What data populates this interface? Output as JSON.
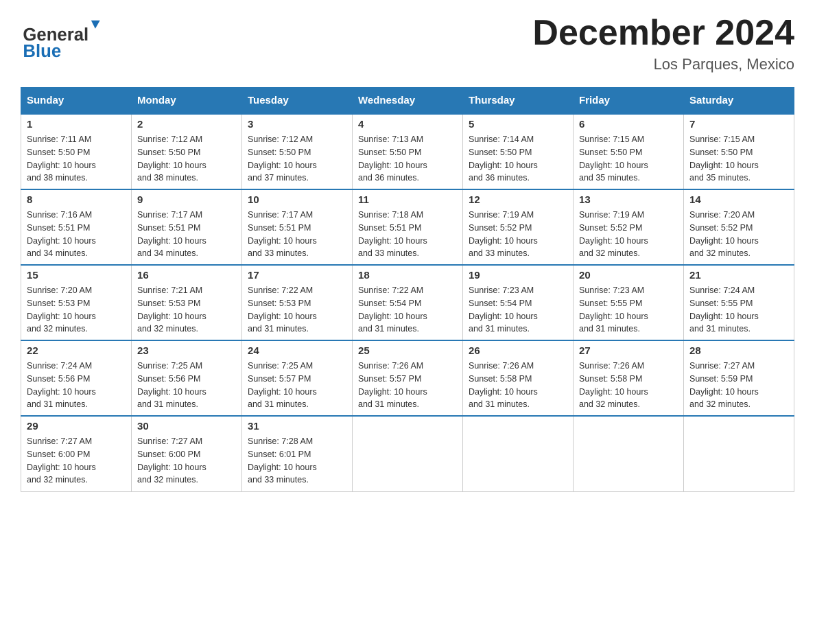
{
  "logo": {
    "general": "General",
    "blue": "Blue",
    "arrow_color": "#1a6eb5"
  },
  "title": {
    "month_year": "December 2024",
    "location": "Los Parques, Mexico"
  },
  "header_days": [
    "Sunday",
    "Monday",
    "Tuesday",
    "Wednesday",
    "Thursday",
    "Friday",
    "Saturday"
  ],
  "weeks": [
    [
      {
        "day": "1",
        "sunrise": "7:11 AM",
        "sunset": "5:50 PM",
        "daylight": "10 hours and 38 minutes."
      },
      {
        "day": "2",
        "sunrise": "7:12 AM",
        "sunset": "5:50 PM",
        "daylight": "10 hours and 38 minutes."
      },
      {
        "day": "3",
        "sunrise": "7:12 AM",
        "sunset": "5:50 PM",
        "daylight": "10 hours and 37 minutes."
      },
      {
        "day": "4",
        "sunrise": "7:13 AM",
        "sunset": "5:50 PM",
        "daylight": "10 hours and 36 minutes."
      },
      {
        "day": "5",
        "sunrise": "7:14 AM",
        "sunset": "5:50 PM",
        "daylight": "10 hours and 36 minutes."
      },
      {
        "day": "6",
        "sunrise": "7:15 AM",
        "sunset": "5:50 PM",
        "daylight": "10 hours and 35 minutes."
      },
      {
        "day": "7",
        "sunrise": "7:15 AM",
        "sunset": "5:50 PM",
        "daylight": "10 hours and 35 minutes."
      }
    ],
    [
      {
        "day": "8",
        "sunrise": "7:16 AM",
        "sunset": "5:51 PM",
        "daylight": "10 hours and 34 minutes."
      },
      {
        "day": "9",
        "sunrise": "7:17 AM",
        "sunset": "5:51 PM",
        "daylight": "10 hours and 34 minutes."
      },
      {
        "day": "10",
        "sunrise": "7:17 AM",
        "sunset": "5:51 PM",
        "daylight": "10 hours and 33 minutes."
      },
      {
        "day": "11",
        "sunrise": "7:18 AM",
        "sunset": "5:51 PM",
        "daylight": "10 hours and 33 minutes."
      },
      {
        "day": "12",
        "sunrise": "7:19 AM",
        "sunset": "5:52 PM",
        "daylight": "10 hours and 33 minutes."
      },
      {
        "day": "13",
        "sunrise": "7:19 AM",
        "sunset": "5:52 PM",
        "daylight": "10 hours and 32 minutes."
      },
      {
        "day": "14",
        "sunrise": "7:20 AM",
        "sunset": "5:52 PM",
        "daylight": "10 hours and 32 minutes."
      }
    ],
    [
      {
        "day": "15",
        "sunrise": "7:20 AM",
        "sunset": "5:53 PM",
        "daylight": "10 hours and 32 minutes."
      },
      {
        "day": "16",
        "sunrise": "7:21 AM",
        "sunset": "5:53 PM",
        "daylight": "10 hours and 32 minutes."
      },
      {
        "day": "17",
        "sunrise": "7:22 AM",
        "sunset": "5:53 PM",
        "daylight": "10 hours and 31 minutes."
      },
      {
        "day": "18",
        "sunrise": "7:22 AM",
        "sunset": "5:54 PM",
        "daylight": "10 hours and 31 minutes."
      },
      {
        "day": "19",
        "sunrise": "7:23 AM",
        "sunset": "5:54 PM",
        "daylight": "10 hours and 31 minutes."
      },
      {
        "day": "20",
        "sunrise": "7:23 AM",
        "sunset": "5:55 PM",
        "daylight": "10 hours and 31 minutes."
      },
      {
        "day": "21",
        "sunrise": "7:24 AM",
        "sunset": "5:55 PM",
        "daylight": "10 hours and 31 minutes."
      }
    ],
    [
      {
        "day": "22",
        "sunrise": "7:24 AM",
        "sunset": "5:56 PM",
        "daylight": "10 hours and 31 minutes."
      },
      {
        "day": "23",
        "sunrise": "7:25 AM",
        "sunset": "5:56 PM",
        "daylight": "10 hours and 31 minutes."
      },
      {
        "day": "24",
        "sunrise": "7:25 AM",
        "sunset": "5:57 PM",
        "daylight": "10 hours and 31 minutes."
      },
      {
        "day": "25",
        "sunrise": "7:26 AM",
        "sunset": "5:57 PM",
        "daylight": "10 hours and 31 minutes."
      },
      {
        "day": "26",
        "sunrise": "7:26 AM",
        "sunset": "5:58 PM",
        "daylight": "10 hours and 31 minutes."
      },
      {
        "day": "27",
        "sunrise": "7:26 AM",
        "sunset": "5:58 PM",
        "daylight": "10 hours and 32 minutes."
      },
      {
        "day": "28",
        "sunrise": "7:27 AM",
        "sunset": "5:59 PM",
        "daylight": "10 hours and 32 minutes."
      }
    ],
    [
      {
        "day": "29",
        "sunrise": "7:27 AM",
        "sunset": "6:00 PM",
        "daylight": "10 hours and 32 minutes."
      },
      {
        "day": "30",
        "sunrise": "7:27 AM",
        "sunset": "6:00 PM",
        "daylight": "10 hours and 32 minutes."
      },
      {
        "day": "31",
        "sunrise": "7:28 AM",
        "sunset": "6:01 PM",
        "daylight": "10 hours and 33 minutes."
      },
      null,
      null,
      null,
      null
    ]
  ],
  "labels": {
    "sunrise": "Sunrise:",
    "sunset": "Sunset:",
    "daylight": "Daylight:"
  }
}
